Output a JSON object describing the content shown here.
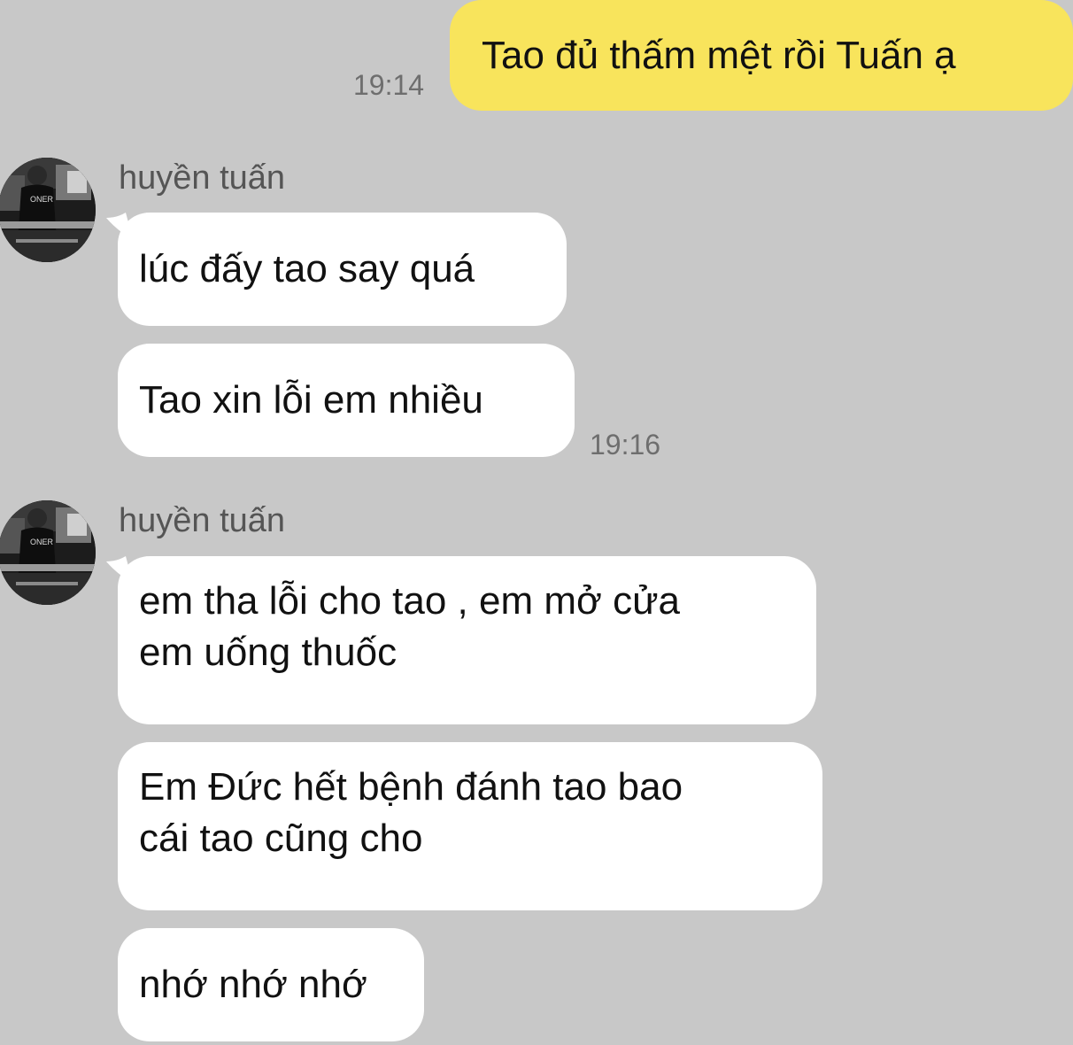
{
  "messages": {
    "outgoing": {
      "text": "Tao đủ thấm mệt rồi Tuấn ạ",
      "time": "19:14"
    },
    "group1": {
      "sender": "huyền tuấn",
      "bubble1": "lúc đấy tao say quá",
      "bubble2": "Tao xin lỗi em nhiều",
      "time": "19:16"
    },
    "group2": {
      "sender": "huyền tuấn",
      "bubble1_line1": "em tha lỗi cho tao , em mở cửa",
      "bubble1_line2": "em uống thuốc",
      "bubble2_line1": "Em Đức hết bệnh đánh tao bao",
      "bubble2_line2": "cái tao cũng cho",
      "bubble3": "nhớ nhớ nhớ"
    }
  },
  "avatar": {
    "shirt_text": "ONER"
  },
  "colors": {
    "background": "#c8c8c8",
    "outgoing_bubble": "#f8e45c",
    "incoming_bubble": "#ffffff",
    "timestamp": "#6e6e6e"
  }
}
